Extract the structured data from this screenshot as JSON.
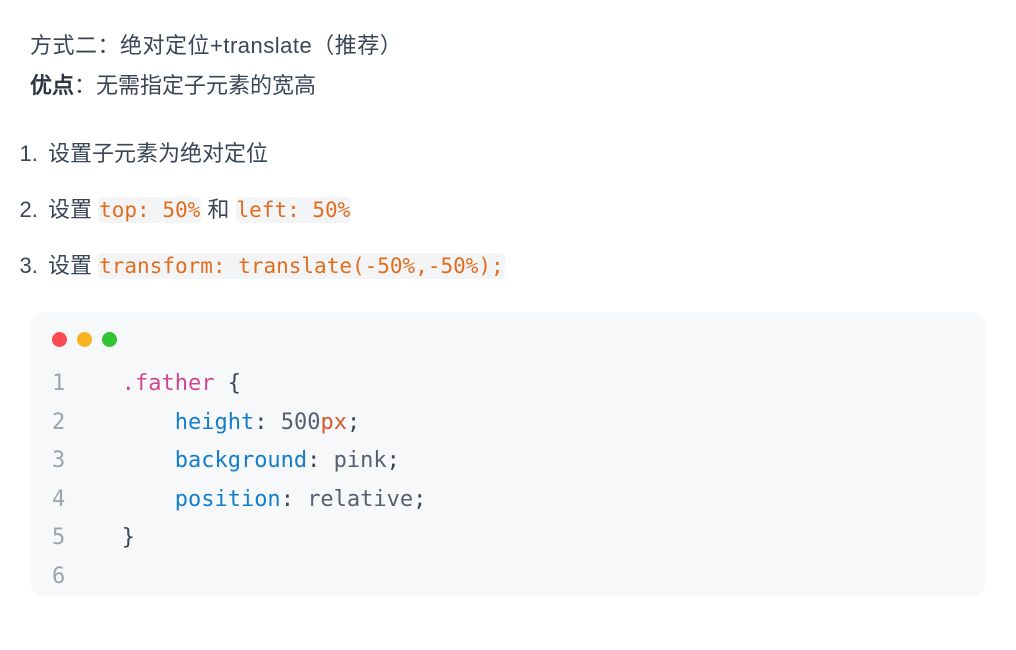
{
  "heading": "方式二：绝对定位+translate（推荐）",
  "adv_label": "优点",
  "adv_text": "：无需指定子元素的宽高",
  "steps": {
    "s1": "设置子元素为绝对定位",
    "s2_a": "设置 ",
    "s2_code1": "top: 50%",
    "s2_b": " 和 ",
    "s2_code2": "left: 50%",
    "s3_a": "设置 ",
    "s3_code": "transform: translate(-50%,-50%);"
  },
  "code": {
    "ln1": "1",
    "ln2": "2",
    "ln3": "3",
    "ln4": "4",
    "ln5": "5",
    "ln6": "6",
    "l1_ind": "   ",
    "l1_sel": ".father",
    "l1_sp": " ",
    "l1_brace": "{",
    "l2_ind": "       ",
    "l2_prop": "height",
    "l2_colon": ":",
    "l2_sp": " ",
    "l2_num": "500",
    "l2_unit": "px",
    "l2_semi": ";",
    "l3_ind": "       ",
    "l3_prop": "background",
    "l3_colon": ":",
    "l3_sp": " ",
    "l3_val": "pink",
    "l3_semi": ";",
    "l4_ind": "       ",
    "l4_prop": "position",
    "l4_colon": ":",
    "l4_sp": " ",
    "l4_val": "relative",
    "l4_semi": ";",
    "l5_ind": "   ",
    "l5_brace": "}"
  }
}
